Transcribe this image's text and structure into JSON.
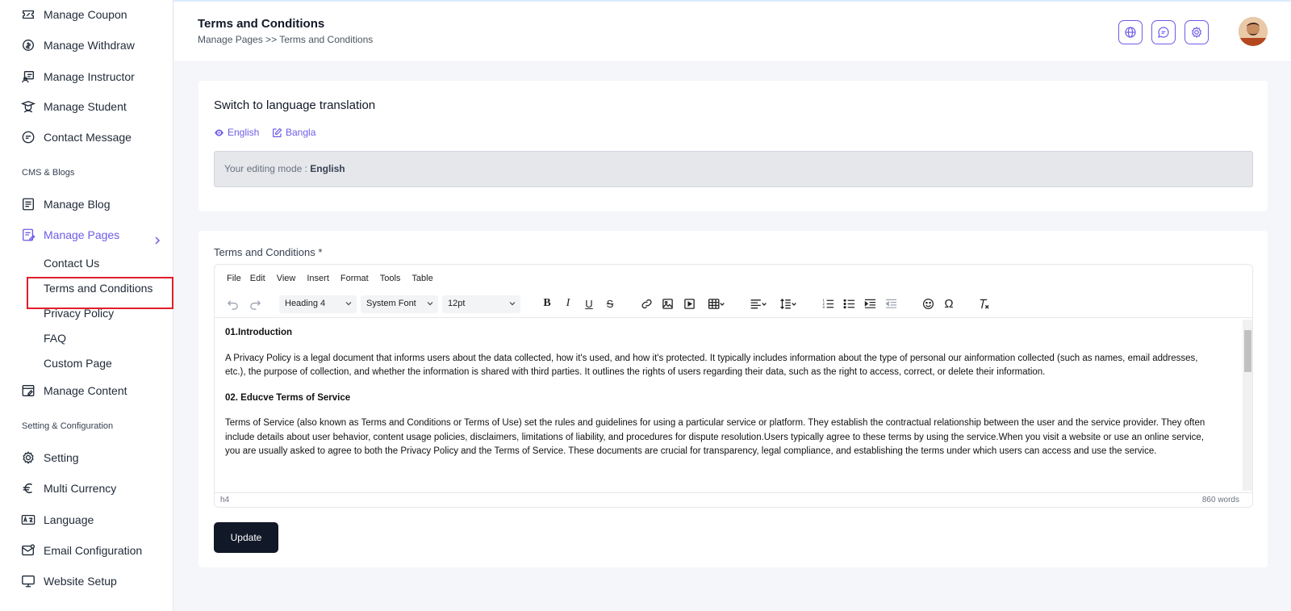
{
  "sidebar": {
    "items_top": [
      {
        "label": "Manage Coupon",
        "icon": "coupon-icon"
      },
      {
        "label": "Manage Withdraw",
        "icon": "withdraw-icon"
      },
      {
        "label": "Manage Instructor",
        "icon": "instructor-icon"
      },
      {
        "label": "Manage Student",
        "icon": "student-icon"
      },
      {
        "label": "Contact Message",
        "icon": "message-icon"
      }
    ],
    "section_cms": "CMS & Blogs",
    "manage_blog": "Manage Blog",
    "manage_pages": "Manage Pages",
    "sub_items": [
      "Contact Us",
      "Terms and Conditions",
      "Privacy Policy",
      "FAQ",
      "Custom Page"
    ],
    "manage_content": "Manage Content",
    "section_setting": "Setting & Configuration",
    "items_bottom": [
      {
        "label": "Setting",
        "icon": "gear-icon"
      },
      {
        "label": "Multi Currency",
        "icon": "euro-icon"
      },
      {
        "label": "Language",
        "icon": "language-icon"
      },
      {
        "label": "Email Configuration",
        "icon": "email-icon"
      },
      {
        "label": "Website Setup",
        "icon": "monitor-icon"
      }
    ],
    "accent": "#6c5ce7"
  },
  "header": {
    "title": "Terms and Conditions",
    "breadcrumb": "Manage Pages >> Terms and Conditions"
  },
  "language_card": {
    "title": "Switch to language translation",
    "languages": [
      "English",
      "Bangla"
    ],
    "mode_label": "Your editing mode : ",
    "mode_value": "English"
  },
  "form": {
    "label": "Terms and Conditions *",
    "menu": [
      "File",
      "Edit",
      "View",
      "Insert",
      "Format",
      "Tools",
      "Table"
    ],
    "block_format": "Heading 4",
    "font_family": "System Font",
    "font_size": "12pt",
    "content": {
      "h1": "01.Introduction",
      "p1": "A Privacy Policy is a legal document that informs users about the data collected, how it's used, and how it's protected. It typically includes information about the type of personal our ainformation collected (such as names, email addresses, etc.), the purpose of collection, and whether the information is shared with third parties. It outlines the rights of users regarding their data, such as the right to access, correct, or delete their information.",
      "h2": "02. Educve Terms of Service",
      "p2": "Terms of Service (also known as Terms and Conditions or Terms of Use) set the rules and guidelines for using a particular service or platform. They establish the contractual relationship between the user and the service provider. They often include details about user behavior, content usage policies, disclaimers, limitations of liability, and procedures for dispute resolution.Users typically agree to these terms by using the service.When you visit a website or use an online service, you are usually asked to agree to both the Privacy Policy and the Terms of Service. These documents are crucial for transparency, legal compliance, and establishing the terms under which users can access and use the service."
    },
    "status_path": "h4",
    "word_count": "860 words",
    "submit_label": "Update"
  }
}
